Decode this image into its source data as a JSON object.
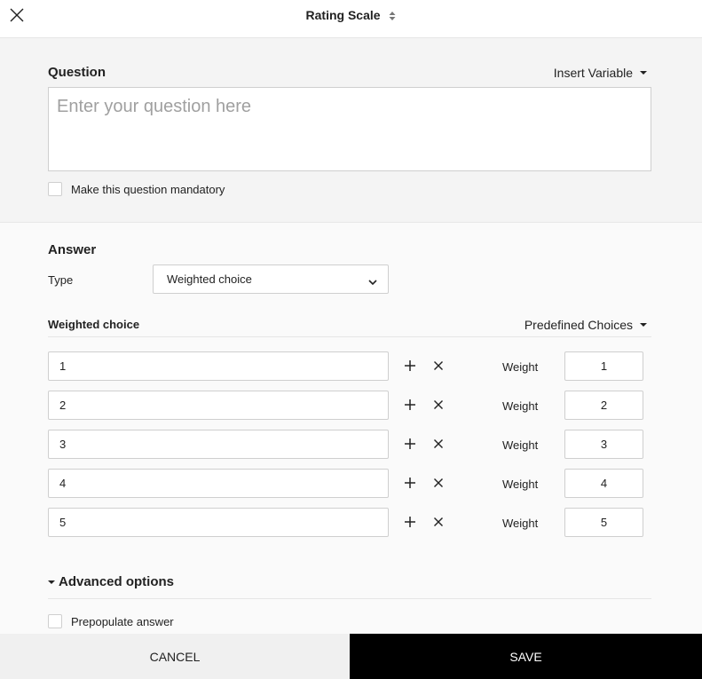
{
  "header": {
    "title": "Rating Scale",
    "close_icon": "close-icon",
    "sort_icon": "sort-updown-icon"
  },
  "question": {
    "label": "Question",
    "insert_variable_label": "Insert Variable",
    "placeholder": "Enter your question here",
    "value": "",
    "mandatory_label": "Make this question mandatory",
    "mandatory_checked": false
  },
  "answer": {
    "label": "Answer",
    "type_label": "Type",
    "type_value": "Weighted choice",
    "weighted_choice_label": "Weighted choice",
    "predefined_choices_label": "Predefined Choices",
    "weight_label": "Weight",
    "choices": [
      {
        "text": "1",
        "weight": "1"
      },
      {
        "text": "2",
        "weight": "2"
      },
      {
        "text": "3",
        "weight": "3"
      },
      {
        "text": "4",
        "weight": "4"
      },
      {
        "text": "5",
        "weight": "5"
      }
    ]
  },
  "advanced": {
    "label": "Advanced options",
    "prepopulate_label": "Prepopulate answer",
    "prepopulate_checked": false
  },
  "footer": {
    "cancel_label": "CANCEL",
    "save_label": "SAVE"
  }
}
